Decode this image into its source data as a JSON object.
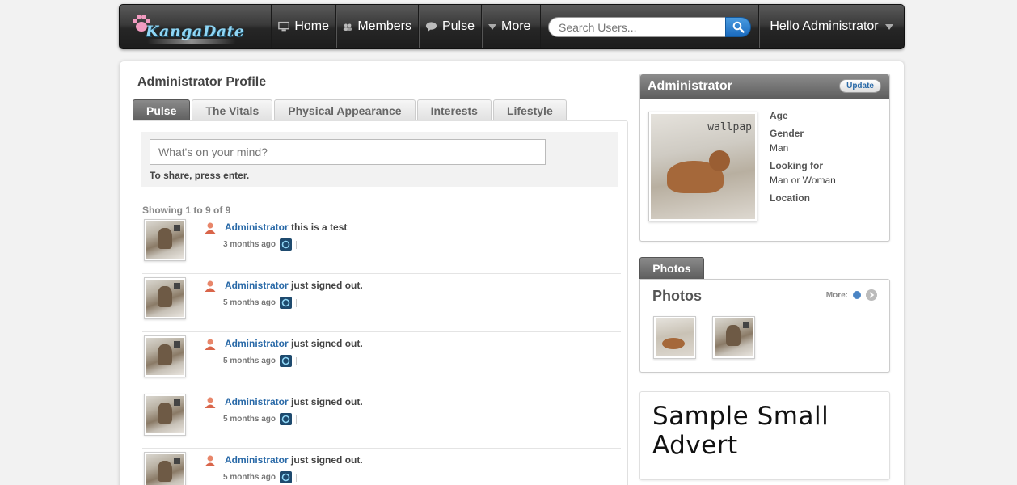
{
  "nav": {
    "logo_text": "KangaDate",
    "home": "Home",
    "members": "Members",
    "pulse": "Pulse",
    "more": "More",
    "search_placeholder": "Search Users...",
    "greeting": "Hello Administrator"
  },
  "profile": {
    "title": "Administrator Profile",
    "tabs": [
      "Pulse",
      "The Vitals",
      "Physical Appearance",
      "Interests",
      "Lifestyle"
    ],
    "active_tab": "Pulse",
    "share_placeholder": "What's on your mind?",
    "share_hint": "To share, press enter.",
    "showing": "Showing 1 to 9 of 9",
    "feed": [
      {
        "name": "Administrator",
        "action": "this is a test",
        "time": "3 months ago"
      },
      {
        "name": "Administrator",
        "action": "just signed out.",
        "time": "5 months ago"
      },
      {
        "name": "Administrator",
        "action": "just signed out.",
        "time": "5 months ago"
      },
      {
        "name": "Administrator",
        "action": "just signed out.",
        "time": "5 months ago"
      },
      {
        "name": "Administrator",
        "action": "just signed out.",
        "time": "5 months ago"
      }
    ]
  },
  "sidebar": {
    "card_title": "Administrator",
    "update_label": "Update",
    "photo_caption": "wallpap",
    "info": {
      "age_label": "Age",
      "gender_label": "Gender",
      "gender_value": "Man",
      "looking_label": "Looking for",
      "looking_value": "Man or Woman",
      "location_label": "Location"
    },
    "photos_tab": "Photos",
    "photos_title": "Photos",
    "photos_more": "More:",
    "advert": "Sample Small Advert"
  },
  "colors": {
    "accent_blue": "#2a6aa8",
    "nav_dark": "#262626",
    "search_blue": "#1a6bbf"
  }
}
